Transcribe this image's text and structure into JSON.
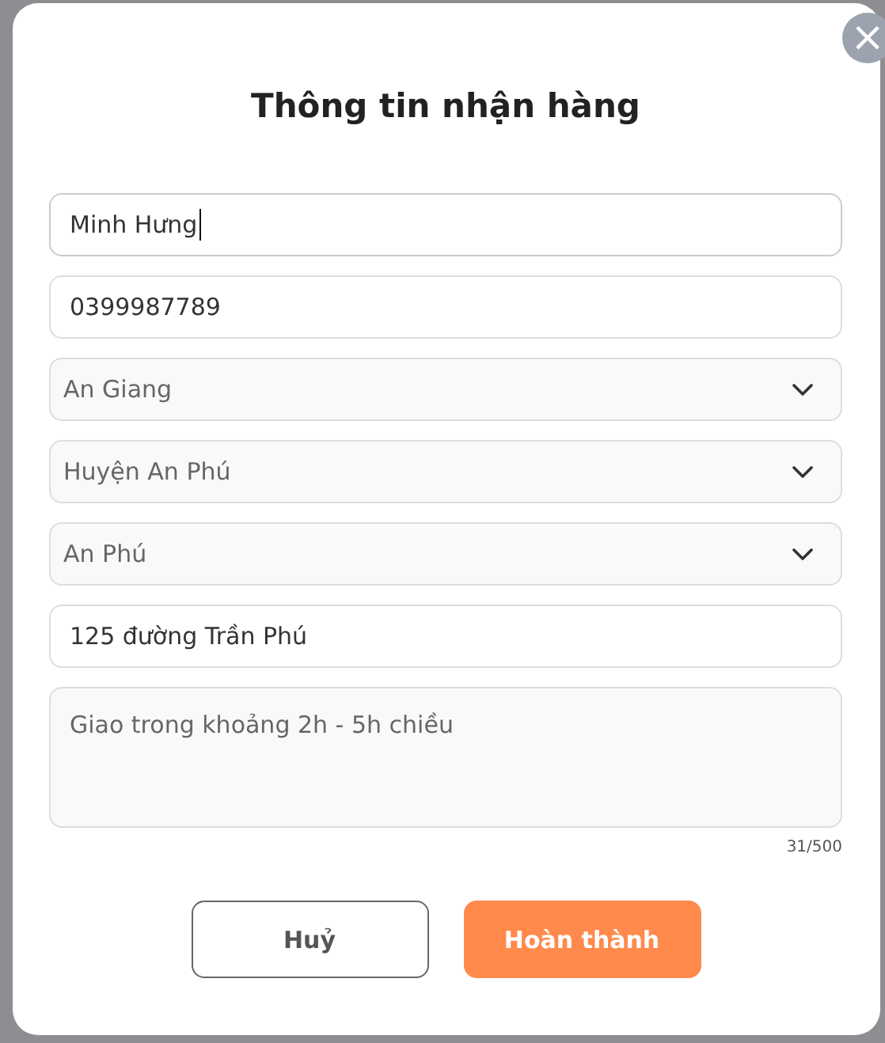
{
  "dialog": {
    "title": "Thông tin nhận hàng",
    "close": "×"
  },
  "fields": [
    {
      "kind": "input",
      "value": "Minh Hưng",
      "focused": true
    },
    {
      "kind": "input",
      "value": "0399987789",
      "focused": false
    },
    {
      "kind": "select",
      "value": "An Giang",
      "focused": false
    },
    {
      "kind": "select",
      "value": "Huyện An Phú",
      "focused": false
    },
    {
      "kind": "select",
      "value": "An Phú",
      "focused": false
    },
    {
      "kind": "input",
      "value": "125 đường Trần Phú",
      "focused": false
    },
    {
      "kind": "textarea",
      "value": "Giao trong khoảng 2h - 5h chiều",
      "focused": false
    }
  ],
  "counter": "31/500",
  "buttons": [
    {
      "kind": "secondary",
      "label": "Huỷ"
    },
    {
      "kind": "primary",
      "label": "Hoàn thành"
    }
  ]
}
